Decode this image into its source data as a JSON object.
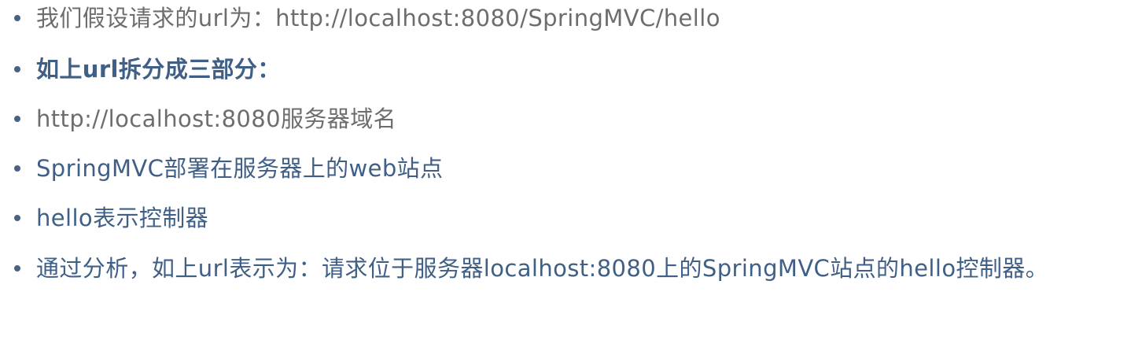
{
  "items": [
    {
      "text": "我们假设请求的url为：http://localhost:8080/SpringMVC/hello"
    },
    {
      "text": "如上url拆分成三部分："
    },
    {
      "text": "http://localhost:8080服务器域名"
    },
    {
      "text": "SpringMVC部署在服务器上的web站点"
    },
    {
      "text": "hello表示控制器"
    },
    {
      "text": "通过分析，如上url表示为：请求位于服务器localhost:8080上的SpringMVC站点的hello控制器。"
    }
  ]
}
